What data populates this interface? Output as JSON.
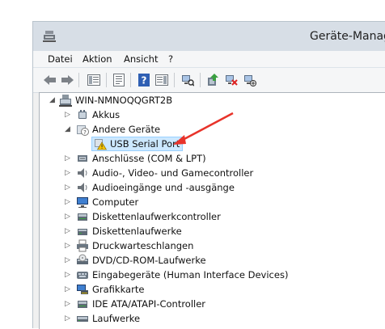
{
  "window": {
    "title": "Geräte-Manag"
  },
  "menu": {
    "items": [
      "Datei",
      "Aktion",
      "Ansicht",
      "?"
    ]
  },
  "toolbar": {
    "buttons": [
      "back-icon",
      "forward-icon",
      "show-hide-tree-icon",
      "properties-icon",
      "help-icon",
      "action-pane-icon",
      "scan-hardware-icon",
      "update-driver-icon",
      "uninstall-icon",
      "disable-icon"
    ]
  },
  "tree": {
    "root": "WIN-NMNOQQGRT2B",
    "nodes": [
      {
        "label": "Akkus",
        "icon": "battery-icon",
        "expanded": false
      },
      {
        "label": "Andere Geräte",
        "icon": "unknown-device-icon",
        "expanded": true
      },
      {
        "label": "USB Serial Port",
        "icon": "warning-device-icon",
        "child": true,
        "selected": true
      },
      {
        "label": "Anschlüsse (COM & LPT)",
        "icon": "port-icon",
        "expanded": false
      },
      {
        "label": "Audio-, Video- und Gamecontroller",
        "icon": "speaker-icon",
        "expanded": false
      },
      {
        "label": "Audioeingänge und -ausgänge",
        "icon": "speaker-icon",
        "expanded": false
      },
      {
        "label": "Computer",
        "icon": "computer-icon",
        "expanded": false
      },
      {
        "label": "Diskettenlaufwerkcontroller",
        "icon": "controller-icon",
        "expanded": false
      },
      {
        "label": "Diskettenlaufwerke",
        "icon": "floppy-icon",
        "expanded": false
      },
      {
        "label": "Druckwarteschlangen",
        "icon": "printer-icon",
        "expanded": false
      },
      {
        "label": "DVD/CD-ROM-Laufwerke",
        "icon": "disc-icon",
        "expanded": false
      },
      {
        "label": "Eingabegeräte (Human Interface Devices)",
        "icon": "hid-icon",
        "expanded": false
      },
      {
        "label": "Grafikkarte",
        "icon": "display-adapter-icon",
        "expanded": false
      },
      {
        "label": "IDE ATA/ATAPI-Controller",
        "icon": "ide-controller-icon",
        "expanded": false
      },
      {
        "label": "Laufwerke",
        "icon": "drive-icon",
        "expanded": false
      }
    ]
  },
  "annotation": {
    "arrow_color": "#e8332a"
  }
}
